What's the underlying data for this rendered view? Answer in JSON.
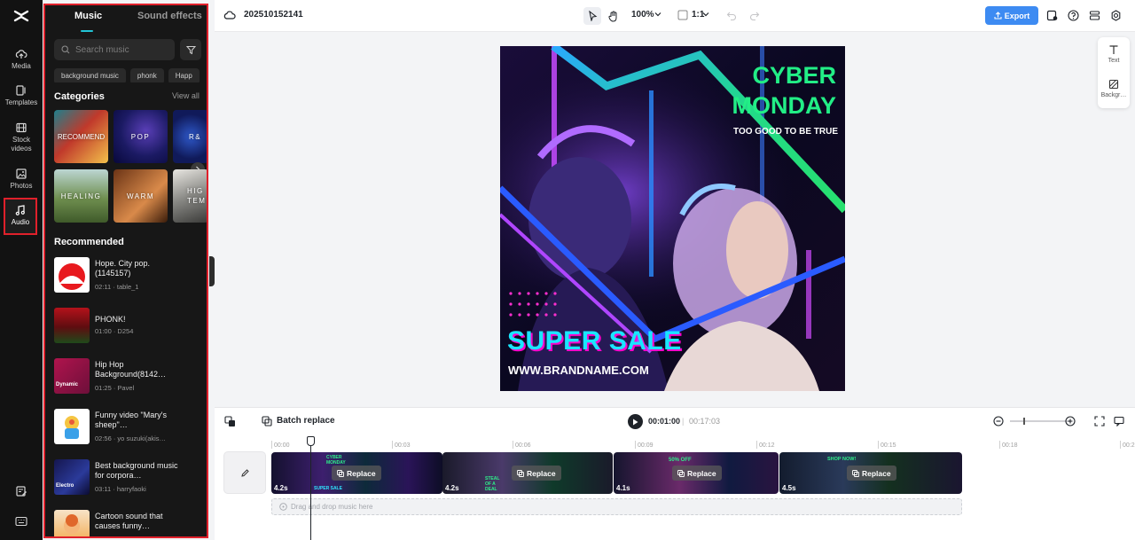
{
  "rail": {
    "items": [
      {
        "label": "Media",
        "icon": "cloud-upload-icon"
      },
      {
        "label": "Templates",
        "icon": "templates-icon"
      },
      {
        "label": "Stock videos",
        "icon": "film-icon"
      },
      {
        "label": "Photos",
        "icon": "image-icon"
      },
      {
        "label": "Audio",
        "icon": "music-note-icon",
        "active": true
      }
    ]
  },
  "panel": {
    "tabs": {
      "music": "Music",
      "sound_effects": "Sound effects"
    },
    "search_placeholder": "Search music",
    "chips": [
      "background music",
      "phonk",
      "Happ"
    ],
    "categories_title": "Categories",
    "view_all": "View all",
    "categories": [
      "RECOMMEND",
      "POP",
      "R&",
      "HEALING",
      "WARM",
      "HIG TEM"
    ],
    "recommended_title": "Recommended",
    "tracks": [
      {
        "title": "Hope. City pop. (1145157)",
        "meta": "02:11 · table_1"
      },
      {
        "title": "PHONK!",
        "meta": "01:00 · D254"
      },
      {
        "title": "Hip Hop Background(8142…",
        "meta": "01:25 · Pavel",
        "thumb_text": "Dynamic"
      },
      {
        "title": "Funny video \"Mary's sheep\"…",
        "meta": "02:56 · yo suzuki(akis…"
      },
      {
        "title": "Best background music for corpora…",
        "meta": "03:11 · harryfaoki",
        "thumb_text": "Electro"
      },
      {
        "title": "Cartoon sound that causes funny…",
        "meta": ""
      }
    ]
  },
  "topbar": {
    "project_name": "202510152141",
    "zoom": "100%",
    "ratio": "1:1",
    "export": "Export"
  },
  "artboard": {
    "headline_1": "CYBER",
    "headline_2": "MONDAY",
    "tagline": "TOO GOOD TO BE TRUE",
    "sale": "SUPER SALE",
    "url": "WWW.BRANDNAME.COM"
  },
  "side_tools": {
    "text": "Text",
    "background": "Backgr…"
  },
  "timeline": {
    "batch_replace": "Batch replace",
    "current_time": "00:01:00",
    "separator": "|",
    "total_time": "00:17:03",
    "ruler": [
      "00:00",
      "00:03",
      "00:06",
      "00:09",
      "00:12",
      "00:15",
      "00:18",
      "00:2"
    ],
    "clips": [
      {
        "duration": "4.2s",
        "replace": "Replace",
        "overlay": [
          "CYBER MONDAY",
          "SUPER SALE"
        ]
      },
      {
        "duration": "4.2s",
        "replace": "Replace",
        "overlay": [
          "STEAL OF A DEAL"
        ]
      },
      {
        "duration": "4.1s",
        "replace": "Replace",
        "overlay": [
          "50% OFF"
        ]
      },
      {
        "duration": "4.5s",
        "replace": "Replace",
        "overlay": [
          "SHOP NOW!"
        ]
      }
    ],
    "music_drop": "Drag and drop music here"
  },
  "colors": {
    "accent": "#3d8bf2",
    "highlight": "#e0202b",
    "tab_underline": "#22c4d6"
  }
}
